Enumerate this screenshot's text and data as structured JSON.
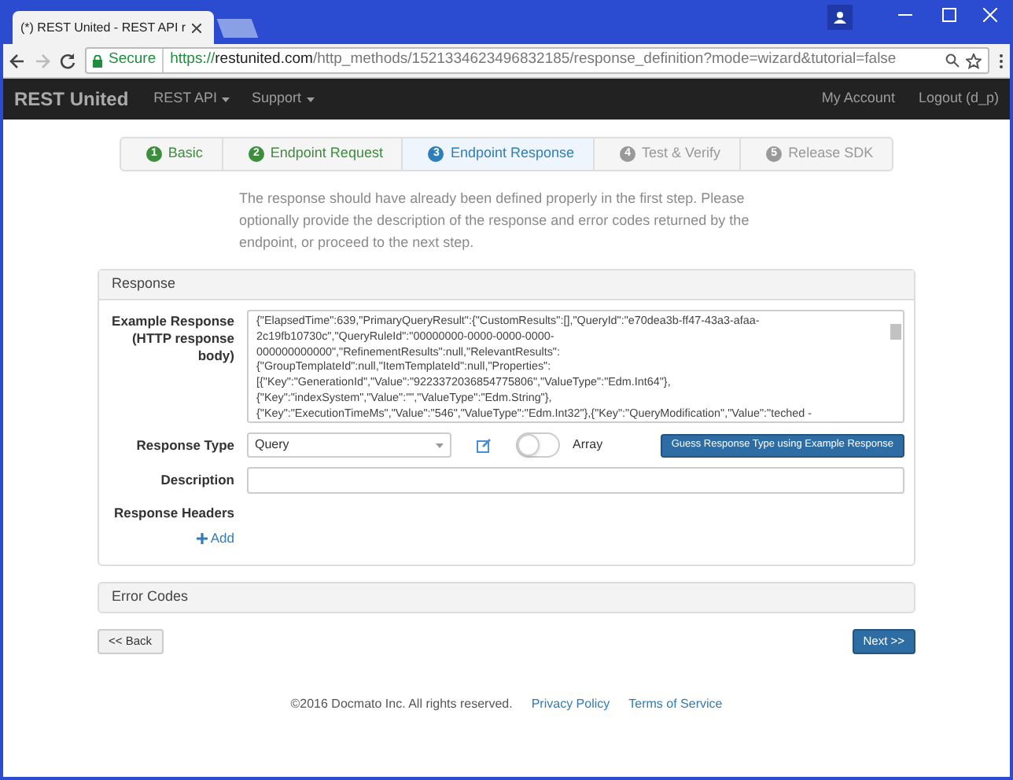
{
  "browser": {
    "tab_title": "(*) REST United - REST API r",
    "secure_label": "Secure",
    "url_scheme": "https://",
    "url_host": "restunited.com",
    "url_path": "/http_methods/1521334623496832185/response_definition?mode=wizard&tutorial=false"
  },
  "navbar": {
    "brand": "REST United",
    "menus": [
      "REST API",
      "Support"
    ],
    "right_links": [
      "My Account",
      "Logout (d_p)"
    ]
  },
  "wizard": {
    "steps": [
      {
        "number": "1",
        "label": "Basic",
        "completed": true,
        "selected": false
      },
      {
        "number": "2",
        "label": "Endpoint Request",
        "completed": true,
        "selected": false
      },
      {
        "number": "3",
        "label": "Endpoint Response",
        "completed": false,
        "selected": true
      },
      {
        "number": "4",
        "label": "Test & Verify",
        "completed": false,
        "selected": false
      },
      {
        "number": "5",
        "label": "Release SDK",
        "completed": false,
        "selected": false
      }
    ],
    "intro": "The response should have already been defined properly in the first step. Please optionally provide the description of the response and error codes returned by the endpoint, or proceed to the next step."
  },
  "response_panel": {
    "title": "Response",
    "example_label": "Example Response (HTTP response body)",
    "example_lines": [
      "{\"ElapsedTime\":639,\"PrimaryQueryResult\":{\"CustomResults\":[],\"QueryId\":\"e70dea3b-ff47-43a3-afaa-",
      "2c19fb10730c\",\"QueryRuleId\":\"00000000-0000-0000-0000-",
      "000000000000\",\"RefinementResults\":null,\"RelevantResults\":",
      "{\"GroupTemplateId\":null,\"ItemTemplateId\":null,\"Properties\":",
      "[{\"Key\":\"GenerationId\",\"Value\":\"9223372036854775806\",\"ValueType\":\"Edm.Int64\"},",
      "{\"Key\":\"indexSystem\",\"Value\":\"\",\"ValueType\":\"Edm.String\"},",
      "{\"Key\":\"ExecutionTimeMs\",\"Value\":\"546\",\"ValueType\":\"Edm.Int32\"},{\"Key\":\"QueryModification\",\"Value\":\"teched -"
    ],
    "type_label": "Response Type",
    "type_value": "Query",
    "array_label": "Array",
    "array_on": false,
    "guess_button": "Guess Response Type using Example Response",
    "description_label": "Description",
    "headers_label": "Response Headers",
    "add_link": "Add"
  },
  "error_panel": {
    "title": "Error Codes"
  },
  "buttons": {
    "back": "<< Back",
    "next": "Next >>"
  },
  "footer": {
    "copyright": "©2016 Docmato Inc. All rights reserved.",
    "links": [
      "Privacy Policy",
      "Terms of Service"
    ]
  }
}
